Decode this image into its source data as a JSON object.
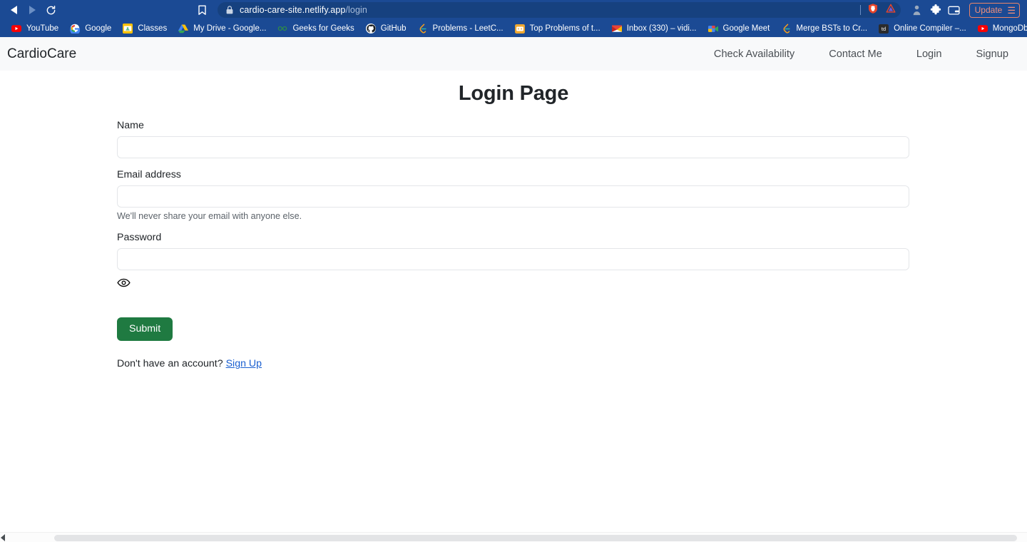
{
  "browser": {
    "name": "brave-browser",
    "toolbar": {
      "back_icon": "back-arrow-icon",
      "forward_icon": "forward-arrow-icon",
      "reload_icon": "reload-icon",
      "reload_glyph": "⟳",
      "bookmark_icon": "bookmark-icon",
      "lock_icon": "lock-icon",
      "url_domain": "cardio-care-site.netlify.app",
      "url_path": "/login",
      "shield_icon": "brave-shields-lion-icon",
      "leo_icon": "brave-leo-ai-icon",
      "profile_icon": "profile-avatar-icon",
      "extensions_icon": "puzzle-piece-extensions-icon",
      "wallet_icon": "brave-wallet-icon",
      "update_label": "Update",
      "menu_glyph": "☰",
      "menu_icon": "hamburger-menu-icon",
      "accent_orange": "#f3907a",
      "chrome_blue": "#1b4a94",
      "urlbar_blue": "#16417f"
    },
    "bookmarks": [
      {
        "label": "YouTube",
        "icon": "youtube-icon"
      },
      {
        "label": "Google",
        "icon": "google-icon"
      },
      {
        "label": "Classes",
        "icon": "google-classroom-icon"
      },
      {
        "label": "My Drive - Google...",
        "icon": "google-drive-icon"
      },
      {
        "label": "Geeks for Geeks",
        "icon": "geeksforgeeks-icon"
      },
      {
        "label": "GitHub",
        "icon": "github-icon"
      },
      {
        "label": "Problems - LeetC...",
        "icon": "leetcode-icon"
      },
      {
        "label": "Top Problems of t...",
        "icon": "generic-orange-icon"
      },
      {
        "label": "Inbox (330) – vidi...",
        "icon": "gmail-icon"
      },
      {
        "label": "Google Meet",
        "icon": "google-meet-icon"
      },
      {
        "label": "Merge BSTs to Cr...",
        "icon": "leetcode-icon"
      },
      {
        "label": "Online Compiler –...",
        "icon": "tutorialspoint-icon"
      },
      {
        "label": "MongoDb Tutorial...",
        "icon": "youtube-icon"
      }
    ],
    "bookmarks_overflow_glyph": "»"
  },
  "site": {
    "navbar": {
      "brand": "CardioCare",
      "links": [
        {
          "label": "Check Availability"
        },
        {
          "label": "Contact Me"
        },
        {
          "label": "Login"
        },
        {
          "label": "Signup"
        }
      ],
      "background": "#f8f9fa"
    },
    "page_title": "Login Page",
    "form": {
      "name_field": {
        "label": "Name",
        "value": "",
        "placeholder": ""
      },
      "email_field": {
        "label": "Email address",
        "value": "",
        "placeholder": "",
        "helper": "We'll never share your email with anyone else."
      },
      "password_field": {
        "label": "Password",
        "value": "",
        "placeholder": "",
        "toggle_icon": "eye-icon"
      },
      "submit_label": "Submit",
      "submit_color": "#1f7a41",
      "signup_prompt": "Don't have an account? ",
      "signup_link_label": "Sign Up",
      "signup_link_color": "#1a5fd0"
    },
    "scrollbar": {
      "orientation": "horizontal",
      "left_arrow_icon": "scroll-left-arrow-icon"
    }
  }
}
